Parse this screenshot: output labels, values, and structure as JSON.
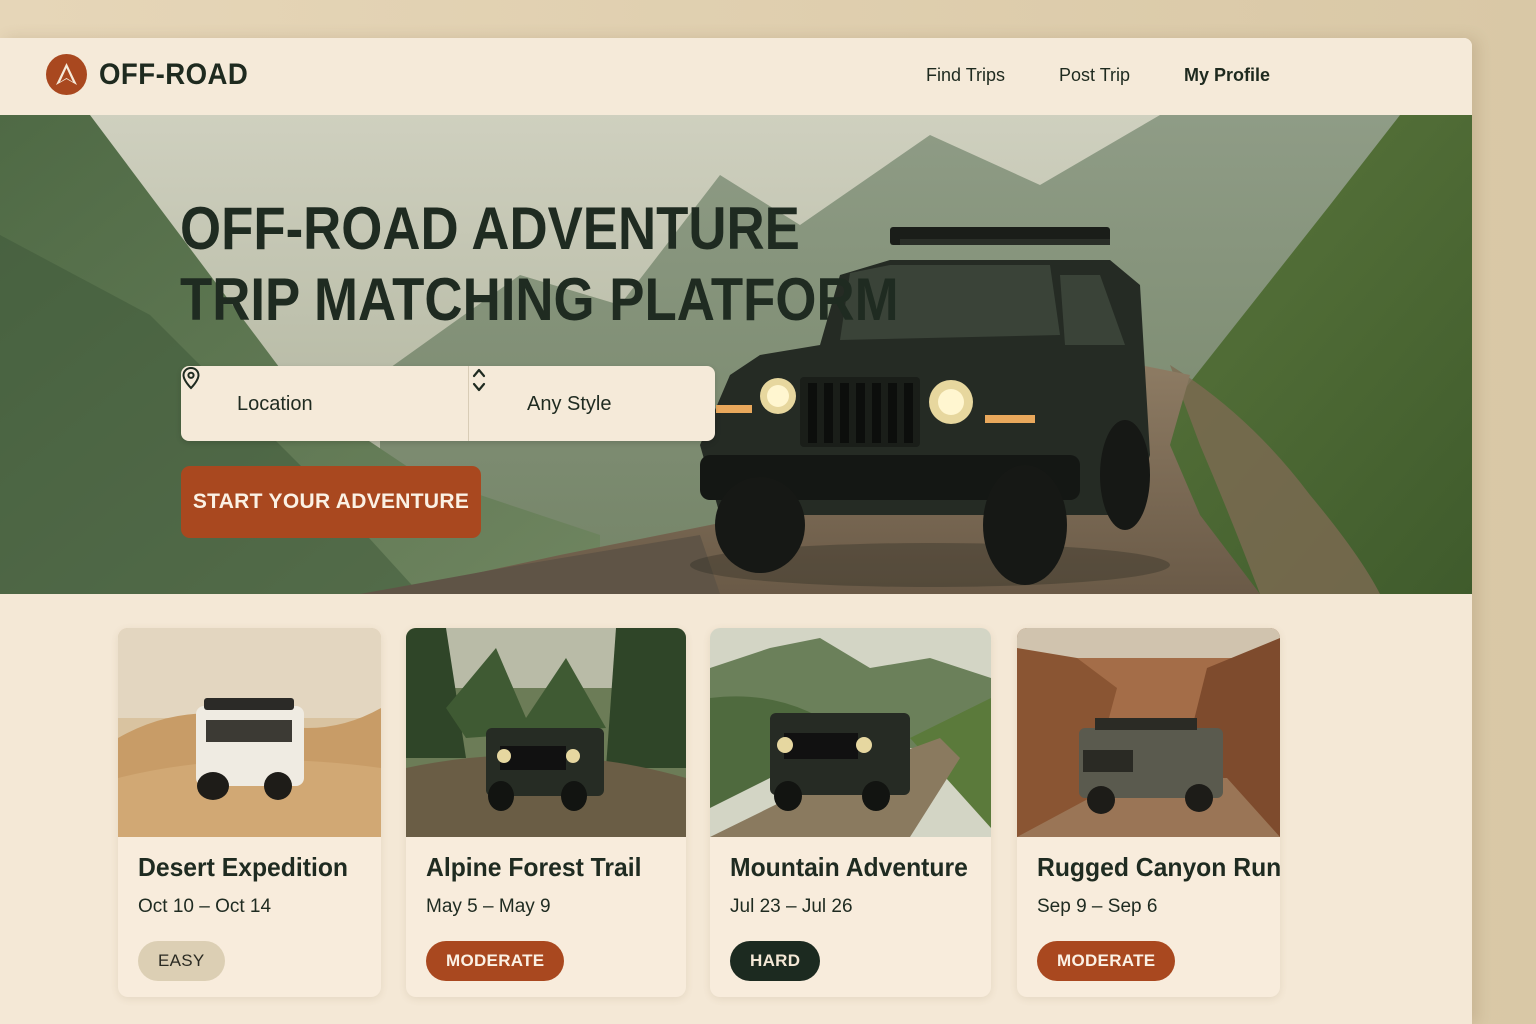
{
  "brand": {
    "name": "OFF-ROAD",
    "accent_color": "#a9481f",
    "logo_icon": "mountain-peak-icon"
  },
  "nav": {
    "items": [
      {
        "label": "Find Trips"
      },
      {
        "label": "Post Trip"
      },
      {
        "label": "My Profile"
      }
    ]
  },
  "hero": {
    "title_line1": "OFF-ROAD ADVENTURE",
    "title_line2": "TRIP MATCHING PLATFORM",
    "search": {
      "location_placeholder": "Location",
      "location_icon": "map-pin-icon",
      "style_value": "Any Style",
      "style_icon": "up-down-arrows-icon"
    },
    "cta_label": "START YOUR ADVENTURE"
  },
  "trips": [
    {
      "title": "Desert Expedition",
      "dates": "Oct 10 – Oct 14",
      "difficulty": "EASY",
      "image": "desert-suv-photo"
    },
    {
      "title": "Alpine Forest Trail",
      "dates": "May 5 – May 9",
      "difficulty": "MODERATE",
      "image": "forest-jeep-photo"
    },
    {
      "title": "Mountain Adventure",
      "dates": "Jul 23 – Jul 26",
      "difficulty": "HARD",
      "image": "mountain-jeep-photo"
    },
    {
      "title": "Rugged Canyon Run",
      "dates": "Sep 9 – Sep 6",
      "difficulty": "MODERATE",
      "image": "canyon-truck-photo"
    }
  ],
  "colors": {
    "page_bg": "#f4e8d6",
    "dark_text": "#1f2b21",
    "easy_badge": "#dccfb4",
    "moderate_badge": "#a9481f",
    "hard_badge": "#1c2a20"
  }
}
